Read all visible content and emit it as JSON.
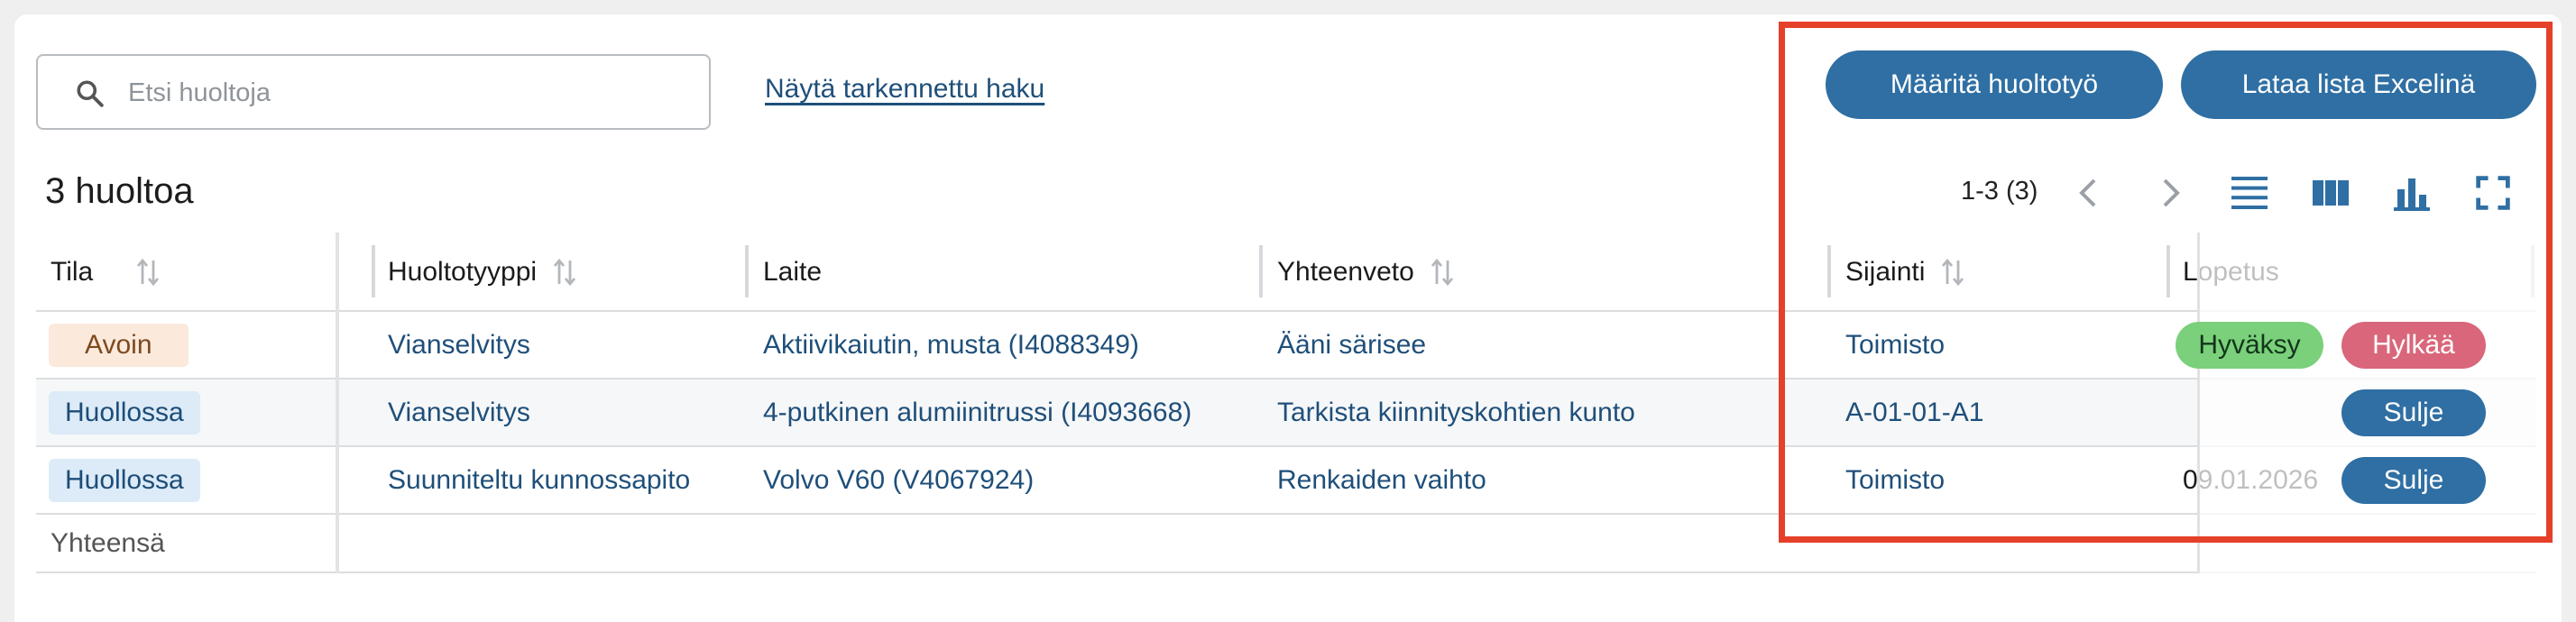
{
  "search": {
    "placeholder": "Etsi huoltoja",
    "value": ""
  },
  "advanced_search_label": "Näytä tarkennettu haku",
  "actions": {
    "define_label": "Määritä huoltotyö",
    "excel_label": "Lataa lista Excelinä"
  },
  "result_count": "3 huoltoa",
  "pagination": {
    "range_text": "1-3 (3)"
  },
  "view_icons": [
    "chevron-left-icon",
    "chevron-right-icon",
    "list-view-icon",
    "columns-view-icon",
    "bar-chart-icon",
    "fullscreen-icon"
  ],
  "table": {
    "columns": [
      "Tila",
      "Huoltotyyppi",
      "Laite",
      "Yhteenveto",
      "Sijainti",
      "Lopetus"
    ],
    "rows": [
      {
        "status": "Avoin",
        "type": "Vianselvitys",
        "device": "Aktiivikaiutin, musta (I4088349)",
        "summary": "Ääni särisee",
        "location": "Toimisto",
        "end": "",
        "actions": [
          "Hyväksy",
          "Hylkää"
        ]
      },
      {
        "status": "Huollossa",
        "type": "Vianselvitys",
        "device": "4-putkinen alumiinitrussi (I4093668)",
        "summary": "Tarkista kiinnityskohtien kunto",
        "location": "A-01-01-A1",
        "end": "",
        "actions": [
          "Sulje"
        ]
      },
      {
        "status": "Huollossa",
        "type": "Suunniteltu kunnossapito",
        "device": "Volvo V60 (V4067924)",
        "summary": "Renkaiden vaihto",
        "location": "Toimisto",
        "end": "09.01.2026",
        "actions": [
          "Sulje"
        ]
      }
    ],
    "footer_label": "Yhteensä"
  },
  "colors": {
    "primary": "#2f6fa3",
    "link": "#1f4f7a",
    "accept": "#7bd07b",
    "reject": "#d9667a",
    "highlight": "#e5402a"
  }
}
